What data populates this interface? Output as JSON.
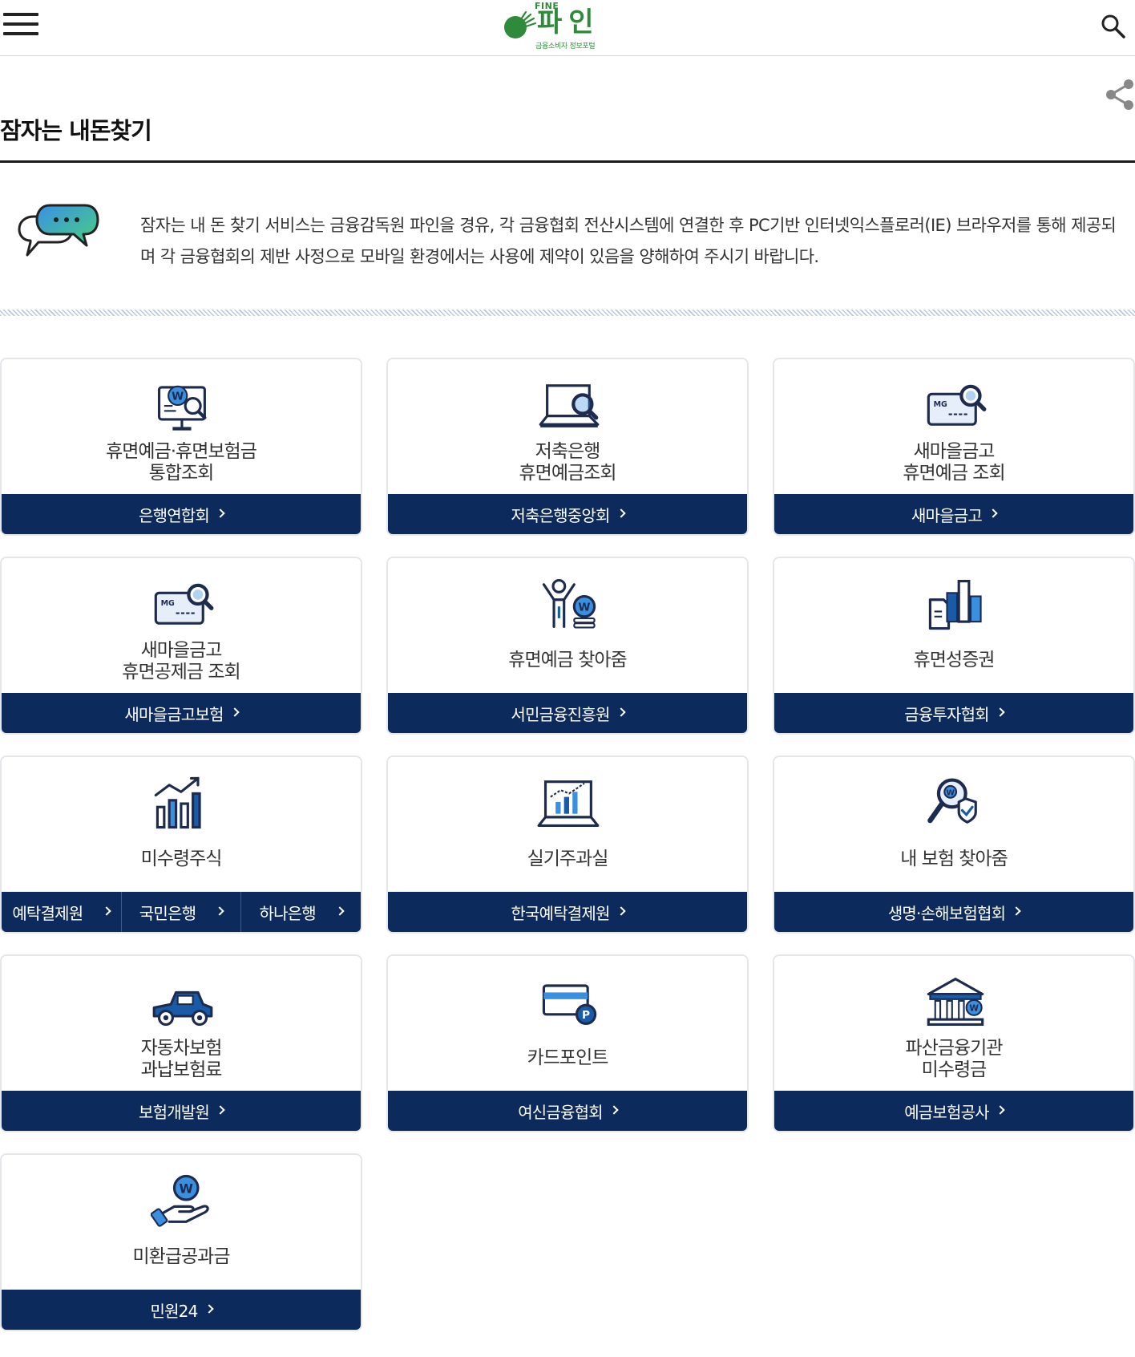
{
  "header": {
    "logo_fine": "FINE",
    "logo_name": "파인",
    "logo_sub": "금융소비자 정보포털"
  },
  "page": {
    "title": "잠자는 내돈찾기",
    "notice": "잠자는 내 돈 찾기 서비스는 금융감독원 파인을 경유, 각 금융협회 전산시스템에 연결한 후 PC기반 인터넷익스플로러(IE) 브라우저를 통해 제공되며 각 금융협회의 제반 사정으로 모바일 환경에서는 사용에 제약이 있음을 양해하여 주시기 바랍니다."
  },
  "cards": [
    {
      "lines": [
        "휴면예금·휴면보험금",
        "통합조회"
      ],
      "icon": "monitor-won-search-icon",
      "buttons": [
        "은행연합회"
      ]
    },
    {
      "lines": [
        "저축은행",
        "휴면예금조회"
      ],
      "icon": "laptop-search-icon",
      "buttons": [
        "저축은행중앙회"
      ]
    },
    {
      "lines": [
        "새마을금고",
        "휴면예금 조회"
      ],
      "icon": "mg-card-search-icon",
      "buttons": [
        "새마을금고"
      ]
    },
    {
      "lines": [
        "새마을금고",
        "휴면공제금 조회"
      ],
      "icon": "mg-card-search-icon",
      "buttons": [
        "새마을금고보험"
      ]
    },
    {
      "lines": [
        "휴면예금 찾아줌"
      ],
      "icon": "person-coin-icon",
      "buttons": [
        "서민금융진흥원"
      ]
    },
    {
      "lines": [
        "휴면성증권"
      ],
      "icon": "document-bars-icon",
      "buttons": [
        "금융투자협회"
      ]
    },
    {
      "lines": [
        "미수령주식"
      ],
      "icon": "bar-chart-up-icon",
      "buttons": [
        "예탁결제원",
        "국민은행",
        "하나은행"
      ]
    },
    {
      "lines": [
        "실기주과실"
      ],
      "icon": "screen-chart-icon",
      "buttons": [
        "한국예탁결제원"
      ]
    },
    {
      "lines": [
        "내 보험 찾아줌"
      ],
      "icon": "magnifier-shield-icon",
      "buttons": [
        "생명·손해보험협회"
      ]
    },
    {
      "lines": [
        "자동차보험",
        "과납보험료"
      ],
      "icon": "car-icon",
      "buttons": [
        "보험개발원"
      ]
    },
    {
      "lines": [
        "카드포인트"
      ],
      "icon": "card-point-icon",
      "buttons": [
        "여신금융협회"
      ]
    },
    {
      "lines": [
        "파산금융기관",
        "미수령금"
      ],
      "icon": "bank-building-icon",
      "buttons": [
        "예금보험공사"
      ]
    },
    {
      "lines": [
        "미환급공과금"
      ],
      "icon": "hand-coin-icon",
      "buttons": [
        "민원24"
      ]
    }
  ],
  "colors": {
    "brand_green": "#2f8b3b",
    "button_navy": "#0d2a5c",
    "icon_blue": "#1a5ba8",
    "icon_light_blue": "#3b8fe0"
  }
}
